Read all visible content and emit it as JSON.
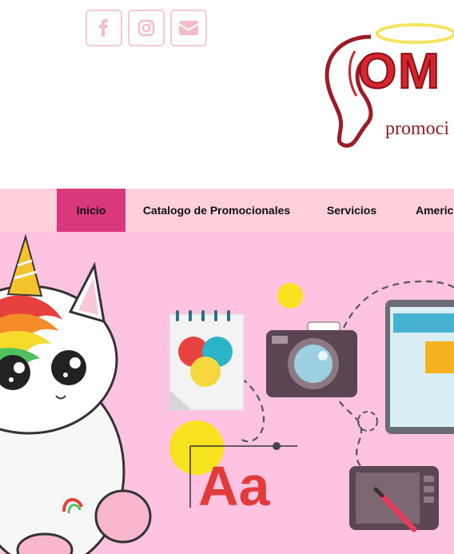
{
  "header": {
    "social": [
      {
        "name": "facebook",
        "icon": "facebook-icon"
      },
      {
        "name": "instagram",
        "icon": "instagram-icon"
      },
      {
        "name": "email",
        "icon": "email-icon"
      }
    ],
    "logo_big": "OM",
    "logo_small": "promoci"
  },
  "nav": {
    "items": [
      {
        "label": "Inicio",
        "active": true
      },
      {
        "label": "Catalogo de Promocionales",
        "active": false
      },
      {
        "label": "Servicios",
        "active": false
      },
      {
        "label": "America",
        "active": false
      }
    ]
  },
  "hero": {
    "text": "Aa"
  },
  "colors": {
    "nav_bg": "#fdd0dc",
    "nav_active": "#d9397a",
    "hero_bg": "#fdc3e1",
    "social_border": "#f7c9d3",
    "logo_red": "#d3262d"
  }
}
